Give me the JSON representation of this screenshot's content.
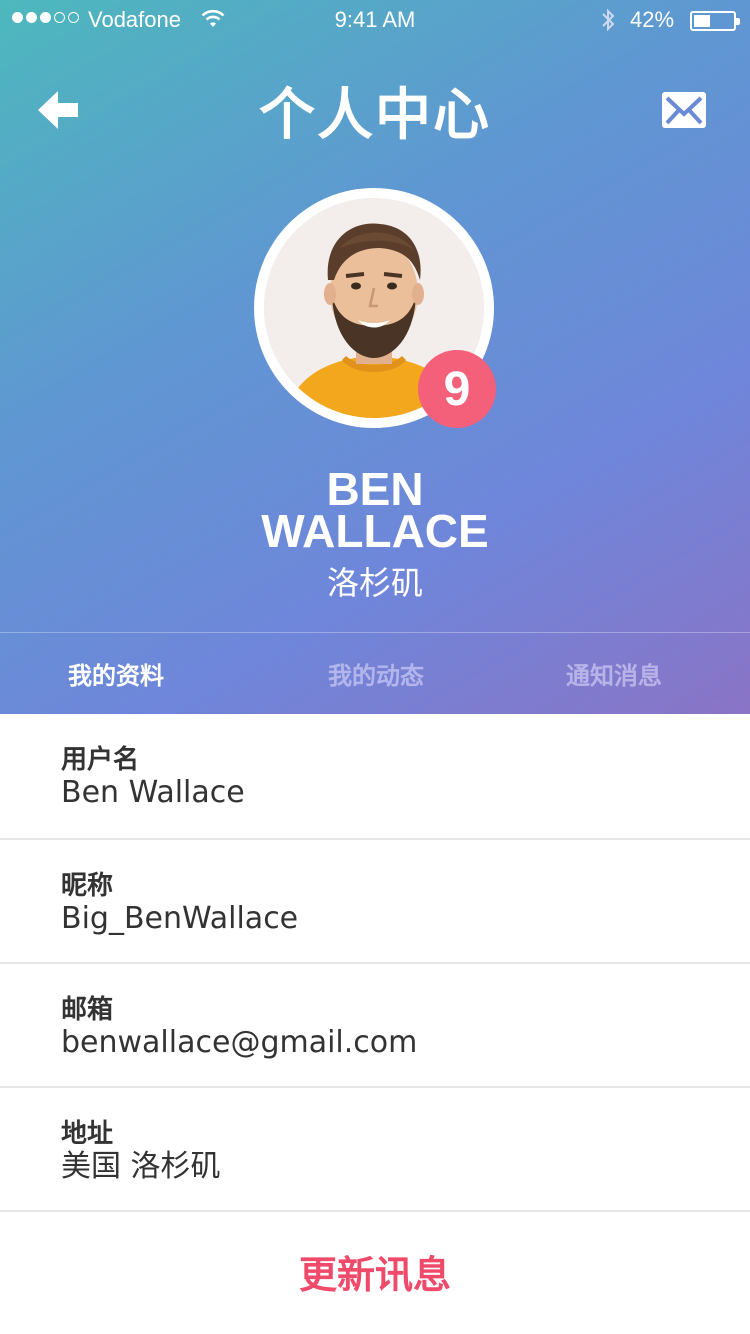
{
  "status_bar": {
    "carrier": "Vodafone",
    "time": "9:41 AM",
    "battery": "42%",
    "battery_level": 0.42,
    "signal_bars": 3,
    "signal_total": 5
  },
  "header": {
    "title": "个人中心",
    "back_icon": "arrow-left-icon",
    "mail_icon": "mail-icon"
  },
  "profile": {
    "badge_count": "9",
    "first_name": "BEN",
    "last_name": "WALLACE",
    "city": "洛杉矶"
  },
  "tabs": [
    {
      "label": "我的资料",
      "active": true
    },
    {
      "label": "我的动态",
      "active": false
    },
    {
      "label": "通知消息",
      "active": false
    }
  ],
  "fields": [
    {
      "label": "用户名",
      "value": "Ben Wallace"
    },
    {
      "label": "昵称",
      "value": "Big_BenWallace"
    },
    {
      "label": "邮箱",
      "value": "benwallace@gmail.com"
    },
    {
      "label": "地址",
      "value": "美国 洛杉矶"
    }
  ],
  "actions": {
    "update_label": "更新讯息"
  },
  "colors": {
    "accent": "#f04a6a",
    "badge": "#f4607a",
    "gradient_start": "#4db8bd",
    "gradient_end": "#8a74c6"
  }
}
